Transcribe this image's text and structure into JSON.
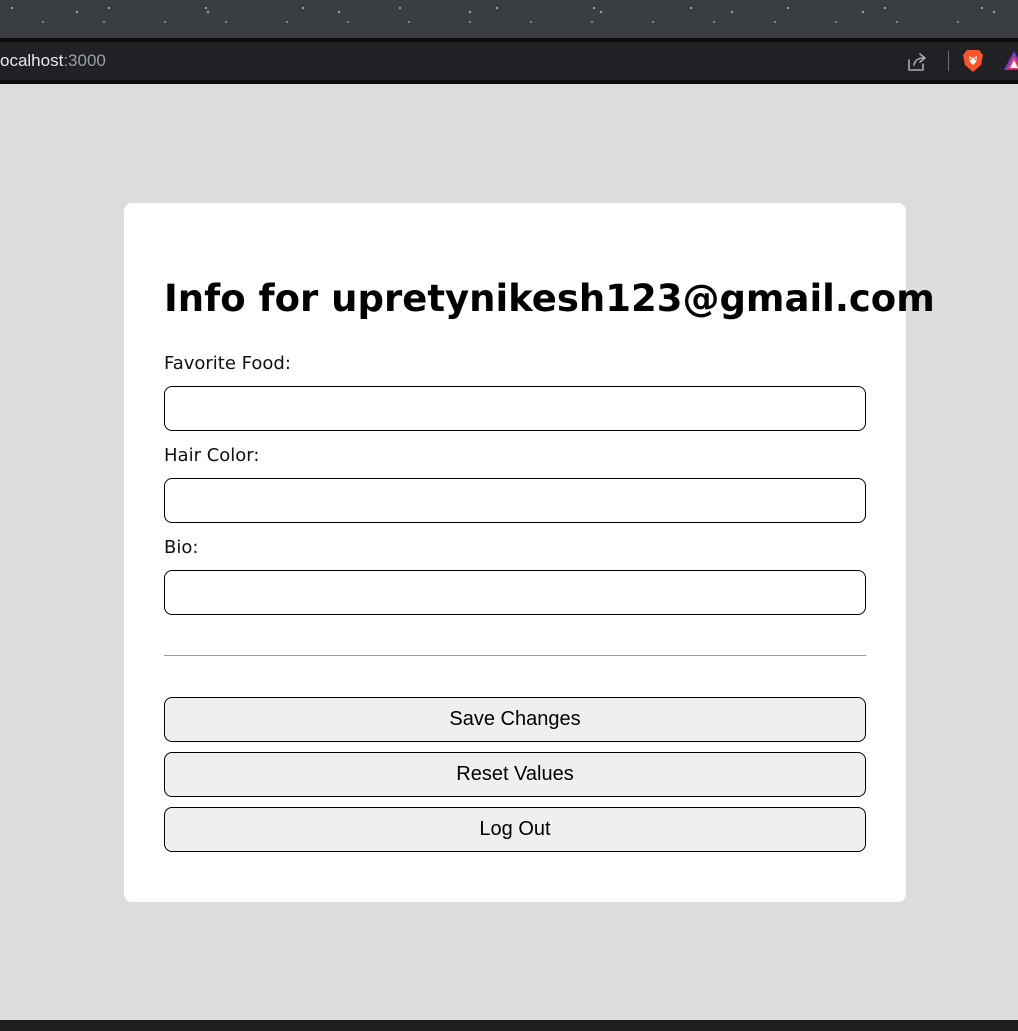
{
  "browser": {
    "url_host": "ocalhost",
    "url_port": ":3000",
    "icons": [
      "share-icon",
      "brave-icon",
      "rewards-icon"
    ]
  },
  "form": {
    "title": "Info for upretynikesh123@gmail.com",
    "fields": [
      {
        "label": "Favorite Food:",
        "value": "",
        "placeholder": ""
      },
      {
        "label": "Hair Color:",
        "value": "",
        "placeholder": ""
      },
      {
        "label": "Bio:",
        "value": "",
        "placeholder": ""
      }
    ],
    "buttons": {
      "save": "Save Changes",
      "reset": "Reset Values",
      "logout": "Log Out"
    }
  },
  "colors": {
    "page_background": "#dcdcdc",
    "card_background": "#ffffff",
    "button_background": "#efefef",
    "address_bar": "#202124",
    "brave_orange": "#fb542b"
  }
}
